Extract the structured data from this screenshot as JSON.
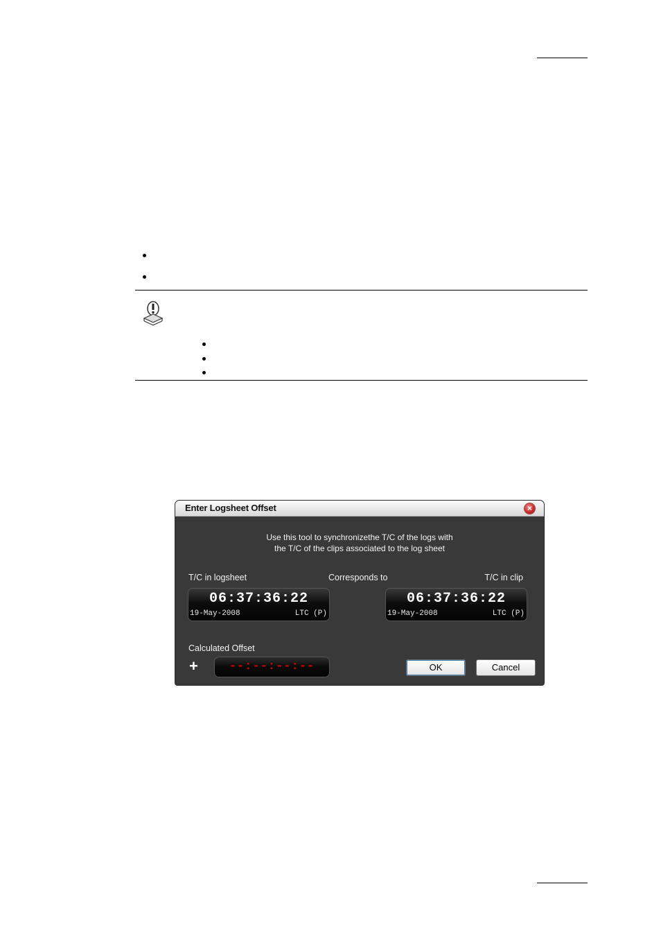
{
  "dialog": {
    "title": "Enter Logsheet Offset",
    "intro_line1": "Use this tool to synchronizethe T/C of the logs with",
    "intro_line2": "the T/C of the clips associated to the log sheet",
    "tc_logsheet_label": "T/C in logsheet",
    "corresponds_label": "Corresponds to",
    "tc_clip_label": "T/C in clip",
    "tc_logsheet": {
      "time": "06:37:36:22",
      "date": "19-May-2008",
      "type": "LTC (P)"
    },
    "tc_clip": {
      "time": "06:37:36:22",
      "date": "19-May-2008",
      "type": "LTC (P)"
    },
    "calculated_offset_label": "Calculated Offset",
    "offset_sign": "+",
    "offset_value": "--:--:--:--",
    "ok_label": "OK",
    "cancel_label": "Cancel",
    "close_glyph": "×"
  },
  "icons": {
    "note": "note-warning-icon",
    "close": "close-icon"
  }
}
